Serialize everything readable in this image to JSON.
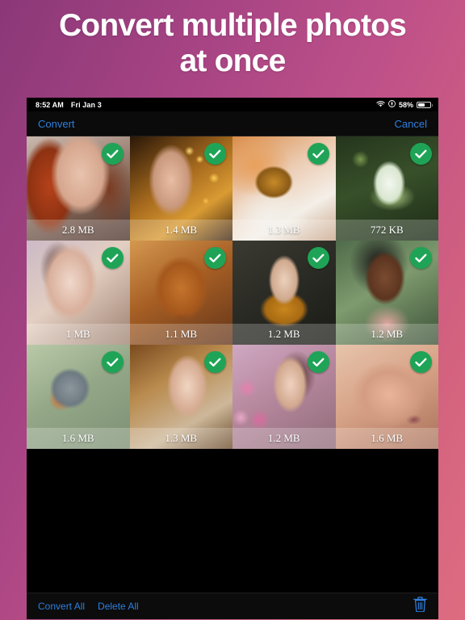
{
  "promo": {
    "line1": "Convert multiple photos",
    "line2": "at once"
  },
  "statusbar": {
    "time": "8:52 AM",
    "date": "Fri Jan 3",
    "wifi_icon": "wifi-icon",
    "location_icon": "location-icon",
    "battery_percent": "58%",
    "battery_level": 58
  },
  "navbar": {
    "left_label": "Convert",
    "right_label": "Cancel"
  },
  "grid": {
    "rows": 3,
    "columns": 4,
    "check_icon": "check-icon",
    "check_color": "#1fa457",
    "items": [
      {
        "size": "2.8 MB",
        "selected": true,
        "subject": "woman-red-hair-portrait"
      },
      {
        "size": "1.4 MB",
        "selected": true,
        "subject": "woman-gold-bokeh-portrait"
      },
      {
        "size": "1.3 MB",
        "selected": true,
        "subject": "orange-white-cat"
      },
      {
        "size": "772 KB",
        "selected": true,
        "subject": "white-lotus-flower"
      },
      {
        "size": "1 MB",
        "selected": true,
        "subject": "woman-earring-portrait"
      },
      {
        "size": "1.1 MB",
        "selected": true,
        "subject": "golden-retriever-dog"
      },
      {
        "size": "1.2 MB",
        "selected": true,
        "subject": "woman-mustard-top-table"
      },
      {
        "size": "1.2 MB",
        "selected": true,
        "subject": "smiling-woman-curly-hair"
      },
      {
        "size": "1.6 MB",
        "selected": true,
        "subject": "european-robin-bird"
      },
      {
        "size": "1.3 MB",
        "selected": true,
        "subject": "woman-red-lipstick-portrait"
      },
      {
        "size": "1.2 MB",
        "selected": true,
        "subject": "woman-with-flowers"
      },
      {
        "size": "1.6 MB",
        "selected": true,
        "subject": "woman-closeup-makeup"
      }
    ]
  },
  "toolbar": {
    "convert_all_label": "Convert All",
    "delete_all_label": "Delete All",
    "trash_icon": "trash-icon"
  },
  "colors": {
    "accent_blue": "#2f7fdd",
    "check_green": "#1fa457",
    "gradient_start": "#8b3878",
    "gradient_end": "#de6c80",
    "device_background": "#000000"
  }
}
